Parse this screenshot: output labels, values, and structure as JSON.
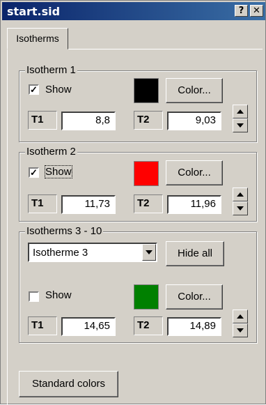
{
  "window": {
    "title": "start.sid",
    "help_label": "?",
    "close_label": "✕"
  },
  "tab": {
    "label": "Isotherms"
  },
  "isotherm1": {
    "legend": "Isotherm 1",
    "show_label": "Show",
    "show_checked": true,
    "color_button": "Color...",
    "swatch_color": "#000000",
    "t1_label": "T1",
    "t1_value": "8,8",
    "t2_label": "T2",
    "t2_value": "9,03"
  },
  "isotherm2": {
    "legend": "Isotherm 2",
    "show_label": "Show",
    "show_checked": true,
    "color_button": "Color...",
    "swatch_color": "#ff0000",
    "t1_label": "T1",
    "t1_value": "11,73",
    "t2_label": "T2",
    "t2_value": "11,96"
  },
  "isotherms3_10": {
    "legend": "Isotherms 3 - 10",
    "select_value": "Isotherme 3",
    "hide_all_button": "Hide all",
    "show_label": "Show",
    "show_checked": false,
    "color_button": "Color...",
    "swatch_color": "#008000",
    "t1_label": "T1",
    "t1_value": "14,65",
    "t2_label": "T2",
    "t2_value": "14,89"
  },
  "standard_colors_button": "Standard colors",
  "checkmark": "✓"
}
